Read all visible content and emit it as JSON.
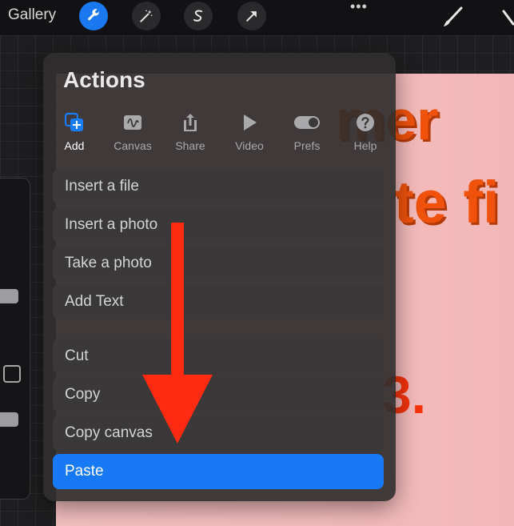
{
  "topbar": {
    "gallery_label": "Gallery",
    "tools": [
      {
        "name": "wrench-icon",
        "active": true
      },
      {
        "name": "magic-wand-icon",
        "active": false
      },
      {
        "name": "selection-s-icon",
        "active": false
      },
      {
        "name": "transform-arrow-icon",
        "active": false
      }
    ],
    "more_label": "•••"
  },
  "actions": {
    "title": "Actions",
    "tabs": [
      {
        "label": "Add",
        "icon": "add-icon",
        "active": true
      },
      {
        "label": "Canvas",
        "icon": "canvas-icon",
        "active": false
      },
      {
        "label": "Share",
        "icon": "share-icon",
        "active": false
      },
      {
        "label": "Video",
        "icon": "video-play-icon",
        "active": false
      },
      {
        "label": "Prefs",
        "icon": "prefs-toggle-icon",
        "active": false
      },
      {
        "label": "Help",
        "icon": "help-icon",
        "active": false
      }
    ],
    "items": [
      {
        "label": "Insert a file"
      },
      {
        "label": "Insert a photo"
      },
      {
        "label": "Take a photo"
      },
      {
        "label": "Add Text"
      },
      {
        "label": "Cut"
      },
      {
        "label": "Copy"
      },
      {
        "label": "Copy canvas"
      },
      {
        "label": "Paste",
        "selected": true
      }
    ]
  },
  "canvas": {
    "text_fragments": [
      "mer",
      "te fi",
      "3."
    ]
  },
  "colors": {
    "accent": "#1779f3",
    "annotation": "#ff2a12"
  }
}
